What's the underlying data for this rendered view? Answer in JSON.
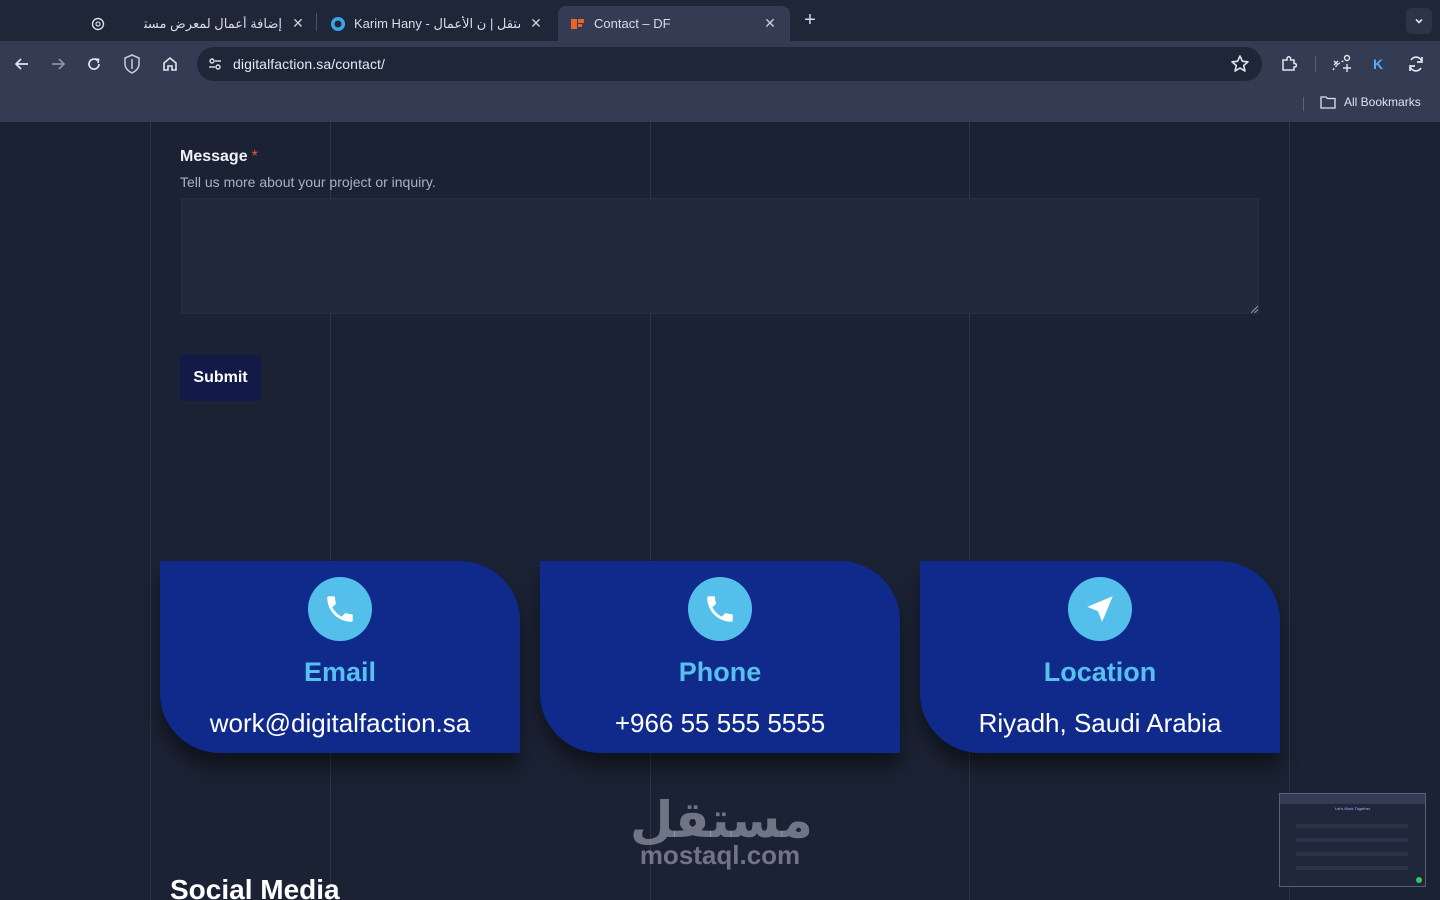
{
  "browser": {
    "tabs": [
      {
        "title": "إضافة أعمال لمعرض مستقل",
        "icon": "openai-icon",
        "active": false
      },
      {
        "title": "Karim Hany - مستقل | ن الأعمال",
        "icon": "mostaql-icon",
        "active": false
      },
      {
        "title": "Contact – DF",
        "icon": "df-icon",
        "active": true
      }
    ],
    "url": "digitalfaction.sa/contact/",
    "profile_initial": "K",
    "bookmarks_label": "All Bookmarks"
  },
  "form": {
    "message_label": "Message",
    "required_mark": "*",
    "message_help": "Tell us more about your project or inquiry.",
    "message_value": "",
    "submit_label": "Submit"
  },
  "contact_cards": [
    {
      "title": "Email",
      "value": "work@digitalfaction.sa",
      "icon": "phone-icon"
    },
    {
      "title": "Phone",
      "value": "+966 55 555 5555",
      "icon": "phone-icon"
    },
    {
      "title": "Location",
      "value": "Riyadh, Saudi Arabia",
      "icon": "navigation-arrow-icon"
    }
  ],
  "watermark": {
    "arabic": "مستقل",
    "latin": "mostaql.com"
  },
  "social_title": "Social Media",
  "thumbnail": {
    "title": "Let's Work Together"
  },
  "colors": {
    "page_bg": "#1b2233",
    "card_bg": "#0f2a8a",
    "accent": "#57c0ee",
    "submit_bg": "#131a48",
    "required": "#e35b3a"
  }
}
